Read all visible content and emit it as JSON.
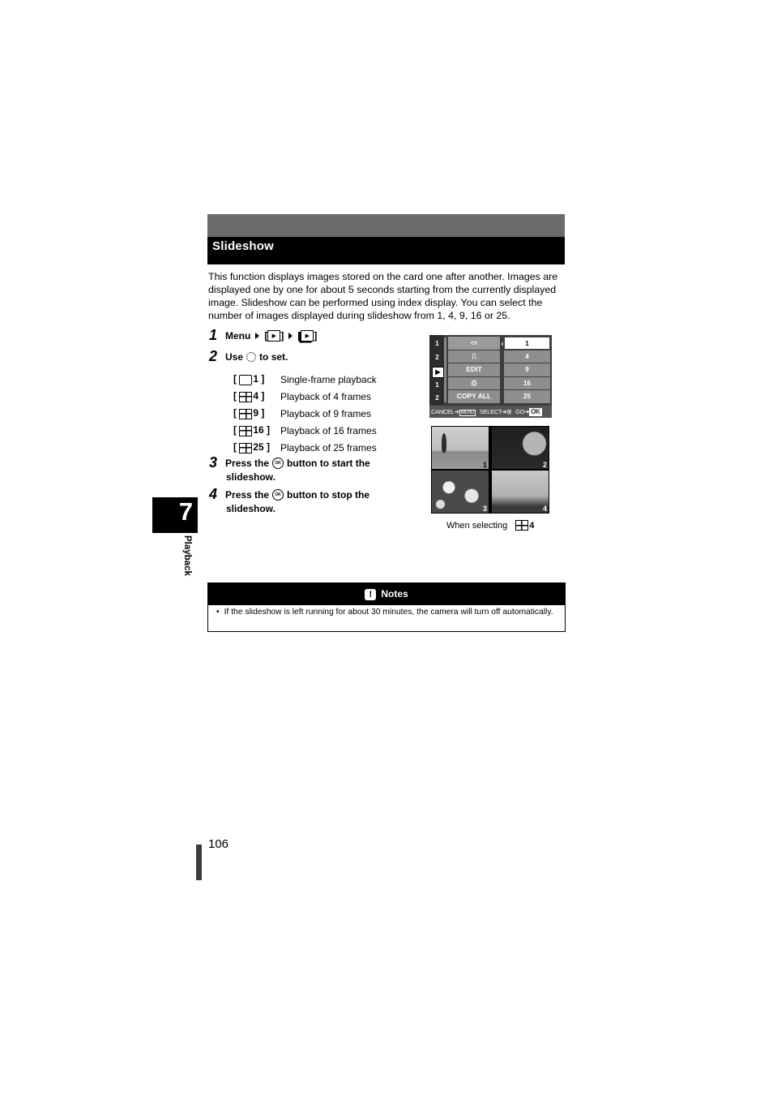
{
  "section": {
    "title": "Slideshow",
    "intro": "This function displays images stored on the card one after another. Images are displayed one by one for about 5 seconds starting from the currently displayed image. Slideshow can be performed using index display. You can select the number of images displayed during slideshow from 1, 4, 9, 16 or 25."
  },
  "steps": [
    {
      "num": "1",
      "parts": [
        "Menu",
        "[",
        "]",
        "[",
        "]"
      ],
      "icons": [
        "play-icon",
        "slideshow-icon"
      ]
    },
    {
      "num": "2",
      "before": "Use",
      "after": "to set."
    },
    {
      "num": "3",
      "before": "Press the",
      "after": "button to start the",
      "line2": "slideshow."
    },
    {
      "num": "4",
      "before": "Press the",
      "after": "button to stop the",
      "line2": "slideshow."
    }
  ],
  "options": [
    {
      "code": "1",
      "icon": "single-frame-icon",
      "desc": "Single-frame playback"
    },
    {
      "code": "4",
      "icon": "grid-4-icon",
      "desc": "Playback of 4 frames"
    },
    {
      "code": "9",
      "icon": "grid-9-icon",
      "desc": "Playback of 9 frames"
    },
    {
      "code": "16",
      "icon": "grid-16-icon",
      "desc": "Playback of 16 frames"
    },
    {
      "code": "25",
      "icon": "grid-25-icon",
      "desc": "Playback of 25 frames"
    }
  ],
  "camera_screen": {
    "side_tabs": [
      "camera-1",
      "camera-2",
      "playback",
      "setup-1",
      "setup-2"
    ],
    "side_labels": [
      "1",
      "2",
      "▶",
      "1",
      "2"
    ],
    "middle_items": [
      "▭",
      "⎍",
      "EDIT",
      "⎙",
      "COPY ALL"
    ],
    "right_items": [
      "1",
      "4",
      "9",
      "16",
      "25"
    ],
    "selected_right": 0,
    "footer": {
      "cancel": "CANCEL",
      "menu": "MENU",
      "select": "SELECT",
      "go": "GO",
      "ok": "OK"
    }
  },
  "photos": {
    "numbers": [
      "1",
      "2",
      "3",
      "4"
    ],
    "caption": "When selecting",
    "caption_code": "4"
  },
  "chapter": {
    "number": "7",
    "label": "Playback"
  },
  "notes": {
    "title": "Notes",
    "icon": "!",
    "items": [
      "If the slideshow is left running for about 30 minutes, the camera will turn off automatically."
    ]
  },
  "page": {
    "number": "106"
  }
}
